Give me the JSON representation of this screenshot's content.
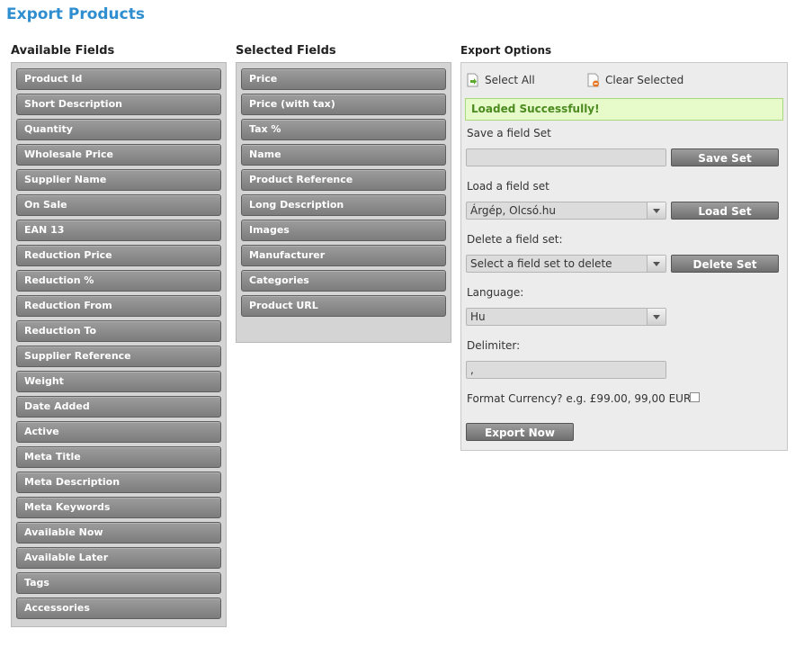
{
  "page": {
    "title": "Export Products"
  },
  "available": {
    "heading": "Available Fields",
    "items": [
      "Product Id",
      "Short Description",
      "Quantity",
      "Wholesale Price",
      "Supplier Name",
      "On Sale",
      "EAN 13",
      "Reduction Price",
      "Reduction %",
      "Reduction From",
      "Reduction To",
      "Supplier Reference",
      "Weight",
      "Date Added",
      "Active",
      "Meta Title",
      "Meta Description",
      "Meta Keywords",
      "Available Now",
      "Available Later",
      "Tags",
      "Accessories"
    ]
  },
  "selected": {
    "heading": "Selected Fields",
    "items": [
      "Price",
      "Price (with tax)",
      "Tax %",
      "Name",
      "Product Reference",
      "Long Description",
      "Images",
      "Manufacturer",
      "Categories",
      "Product URL"
    ]
  },
  "options": {
    "heading": "Export Options",
    "select_all": "Select All",
    "clear_selected": "Clear Selected",
    "success_message": "Loaded Successfully!",
    "save_label": "Save a field Set",
    "save_value": "",
    "save_button": "Save Set",
    "load_label": "Load a field set",
    "load_value": "Árgép, Olcsó.hu",
    "load_button": "Load Set",
    "delete_label": "Delete a field set:",
    "delete_value": "Select a field set to delete",
    "delete_button": "Delete Set",
    "language_label": "Language:",
    "language_value": "Hu",
    "delimiter_label": "Delimiter:",
    "delimiter_value": ",",
    "format_label": "Format Currency? e.g. £99.00, 99,00 EUR",
    "format_checked": false,
    "export_button": "Export Now"
  },
  "colors": {
    "title": "#2f8ed0",
    "field_button": "#8a8a8a",
    "success_bg": "#e6fbc9",
    "success_text": "#4b8a1f"
  }
}
